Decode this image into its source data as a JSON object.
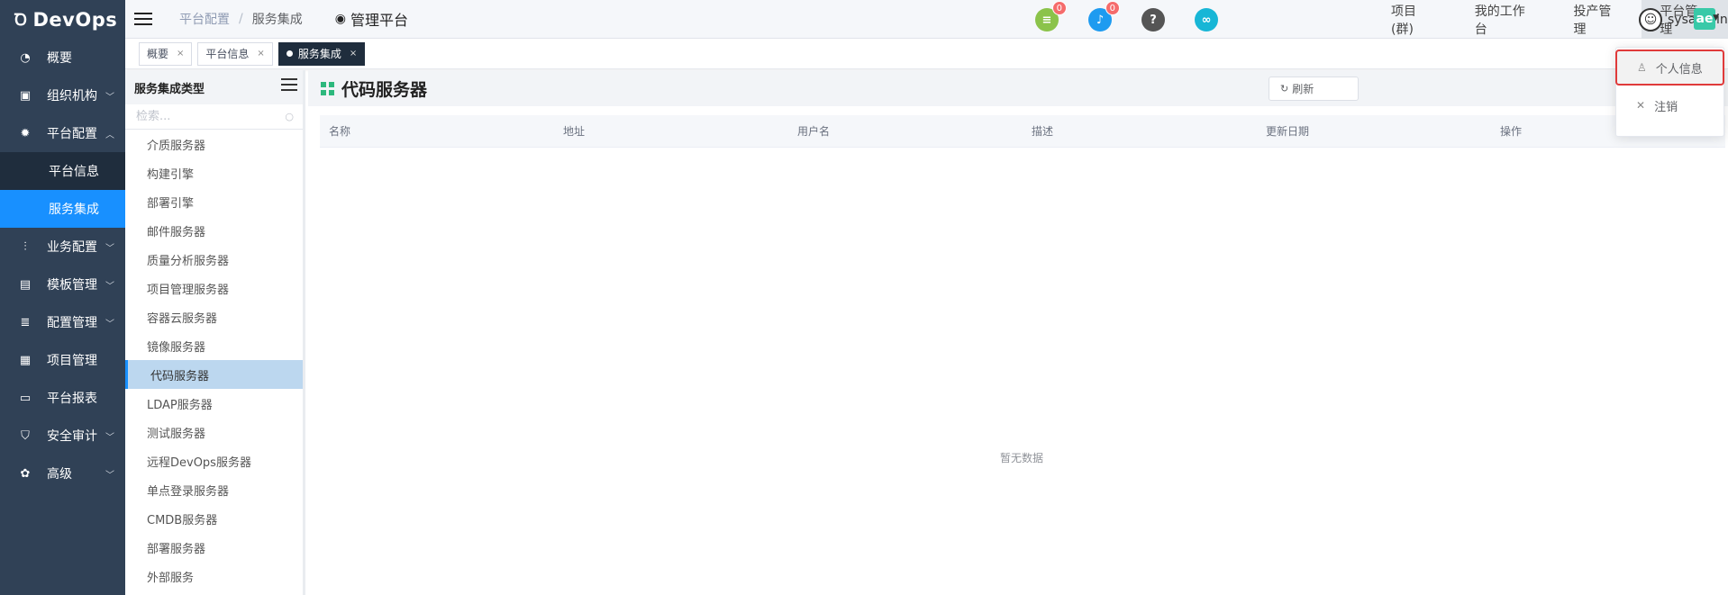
{
  "app": {
    "logo_mark": "Ꝺ",
    "logo": "DevOps"
  },
  "sidebar": {
    "items": [
      {
        "label": "概要"
      },
      {
        "label": "组织机构"
      },
      {
        "label": "平台配置"
      },
      {
        "label": "业务配置"
      },
      {
        "label": "模板管理"
      },
      {
        "label": "配置管理"
      },
      {
        "label": "项目管理"
      },
      {
        "label": "平台报表"
      },
      {
        "label": "安全审计"
      },
      {
        "label": "高级"
      }
    ],
    "sub_items": [
      {
        "label": "平台信息"
      },
      {
        "label": "服务集成"
      }
    ]
  },
  "breadcrumb": {
    "items": [
      "平台配置",
      "服务集成"
    ],
    "separator": "/"
  },
  "platform_title": "管理平台",
  "badges": {
    "docs": "0",
    "notifications": "0"
  },
  "top_menu": [
    "项目(群)",
    "我的工作台",
    "投产管理",
    "平台管理"
  ],
  "user": {
    "name": "sysadmin",
    "app_badge": "ae"
  },
  "tags": [
    {
      "label": "概要"
    },
    {
      "label": "平台信息"
    },
    {
      "label": "服务集成"
    }
  ],
  "tree": {
    "title": "服务集成类型",
    "search_placeholder": "检索...",
    "items": [
      "介质服务器",
      "构建引擎",
      "部署引擎",
      "邮件服务器",
      "质量分析服务器",
      "项目管理服务器",
      "容器云服务器",
      "镜像服务器",
      "代码服务器",
      "LDAP服务器",
      "测试服务器",
      "远程DevOps服务器",
      "单点登录服务器",
      "CMDB服务器",
      "部署服务器",
      "外部服务"
    ]
  },
  "main": {
    "title": "代码服务器",
    "refresh_label": "刷新",
    "columns": [
      "名称",
      "地址",
      "用户名",
      "描述",
      "更新日期",
      "操作"
    ],
    "empty_text": "暂无数据"
  },
  "dropdown": {
    "items": [
      {
        "label": "个人信息"
      },
      {
        "label": "注销"
      }
    ]
  },
  "colors": {
    "sidebar_bg": "#304156",
    "active_blue": "#1890ff",
    "accent_green": "#2db87d",
    "highlight_red": "#e03a3a"
  }
}
